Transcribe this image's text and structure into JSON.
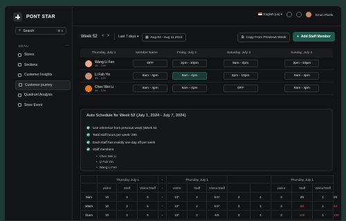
{
  "brand": {
    "name": "PONT STAR"
  },
  "search": {
    "label": "Search",
    "shortcut": "⌘ k"
  },
  "menu": {
    "title": "MENU",
    "more": "···",
    "items": [
      {
        "label": "Stores",
        "icon": "store-icon"
      },
      {
        "label": "Sections",
        "icon": "sections-icon"
      },
      {
        "label": "Customer Insights",
        "icon": "insights-icon"
      },
      {
        "label": "Customer journey",
        "icon": "journey-icon",
        "active": true
      },
      {
        "label": "Quadrant Analysis",
        "icon": "quadrant-icon"
      },
      {
        "label": "Store Event",
        "icon": "event-icon"
      }
    ]
  },
  "topbar": {
    "language": "English (us)",
    "user": "Emon Pixels"
  },
  "toolbar": {
    "week": "Week 52",
    "prev": "<",
    "next": ">",
    "period": "Last 7 days",
    "date_range": "Aug 04 - Aug 11 2023",
    "copy_label": "Copy From Previews Week",
    "add_label": "Add Staff Member"
  },
  "schedule": {
    "headers": [
      "Thursday, July 1",
      "Member Name",
      "Friday, July 2",
      "Saturday, July 3",
      "Sunday, July 4"
    ],
    "rows": [
      {
        "name": "Wang Li Fen",
        "hours": "4th - 12hr",
        "avatar_color": "#e8a88f",
        "shifts": [
          "OFF",
          "2pm - 10pm",
          "8am - 4pm",
          "2pm - 10pm"
        ],
        "highlight": -1
      },
      {
        "name": "Li Fah Yin",
        "hours": "4th - 12hr",
        "avatar_color": "#c98f7a",
        "shifts": [
          "8am - 4pm",
          "8am - 4pm",
          "2pm - 10pm",
          "8am - 4pm"
        ],
        "highlight": 1
      },
      {
        "name": "Chen Wei Li",
        "hours": "4th - 12hr",
        "avatar_color": "#e07a2a",
        "shifts": [
          "8am - 4pm",
          "8am - 4pm",
          "OFF",
          "8am - 4pm"
        ],
        "highlight": -1
      }
    ]
  },
  "auto": {
    "title": "Auto Schedule for Week 52 (July 1, 2024 - July 7, 2024)",
    "bullets": [
      "Use reference from previous week (Week 51",
      "Total staff hours per week: 295",
      "Each staff has exactly one day off per week",
      "Staff members"
    ],
    "members": [
      "Chen Wei Li",
      "Li Fah Yin",
      "Wang Li Fen"
    ]
  },
  "stats": {
    "groups": [
      "",
      "Thursday, July 1",
      "",
      "-",
      "Thursday, July 1",
      "",
      "",
      "Thursday, July 1",
      "",
      ""
    ],
    "sub": [
      "",
      "visitor",
      "Staff",
      "Visitor/Staff",
      "-",
      "visitor",
      "Staff",
      "Visitor/Staff",
      "visitor",
      "Staff",
      "Visitor/Staff"
    ],
    "rows": [
      {
        "time": "9am",
        "cells": [
          "10",
          "2",
          "5",
          "-",
          "13*",
          "2",
          "6.5*",
          "3",
          "1",
          "3",
          "20",
          "1",
          "20"
        ],
        "red": []
      },
      {
        "time": "10am",
        "cells": [
          "10",
          "2",
          "5",
          "-",
          "13*",
          "2",
          "6.5*",
          "3",
          "1",
          "3",
          "60",
          "1",
          "44"
        ],
        "red": [
          10,
          12
        ]
      },
      {
        "time": "11am",
        "cells": [
          "10",
          "2",
          "5",
          "-",
          "13*",
          "2",
          "6.5",
          "3",
          "1",
          "3",
          "100",
          "1",
          "100"
        ],
        "red": [
          10,
          12
        ]
      }
    ]
  }
}
